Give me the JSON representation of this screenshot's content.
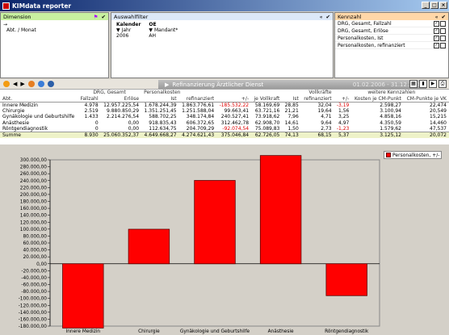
{
  "app": {
    "title": "KIMdata reporter"
  },
  "window_buttons": [
    "_",
    "□",
    "×"
  ],
  "panels": {
    "dimension": {
      "label": "Dimension",
      "item_arrow": "→",
      "item": "Abt. / Monat"
    },
    "filter": {
      "label": "Auswahlfilter",
      "kalender_label": "Kalender",
      "kalender_sub": "Jahr",
      "kalender_val": "2006",
      "oe_label": "OE",
      "oe_sub": "Mandant*",
      "oe_val": "AH"
    },
    "kennzahl": {
      "label": "Kennzahl",
      "items": [
        "DRG, Gesamt, Fallzahl",
        "DRG, Gesamt, Erlöse",
        "Personalkosten, Ist",
        "Personalkosten, refinanziert"
      ]
    }
  },
  "report": {
    "title": "Refinanzierung Ärztlicher Dienst",
    "date_range": "01.02.2006 - 31.12.2006"
  },
  "table": {
    "group_headers": {
      "drg": "DRG, Gesamt",
      "personal": "Personalkosten",
      "vollkraefte": "Vollkräfte",
      "weitere": "weitere Kennzahlen"
    },
    "columns": [
      "Abt.",
      "Fallzahl",
      "Erlöse",
      "Ist",
      "refinanziert",
      "+/-",
      "je Vollkraft",
      "Ist",
      "refinanziert",
      "+/-",
      "Kosten je CM-Punkt",
      "CM-Punkte je VK"
    ],
    "rows": [
      [
        "Innere Medizin",
        "4.978",
        "12.957.225,54",
        "1.678.244,39",
        "1.863.776,61",
        "-185.532,22",
        "58.169,69",
        "28,85",
        "32,04",
        "-3,19",
        "2.598,27",
        "22,474"
      ],
      [
        "Chirurgie",
        "2.519",
        "9.880.850,29",
        "1.351.251,45",
        "1.251.588,04",
        "99.663,41",
        "63.721,16",
        "21,21",
        "19,64",
        "1,56",
        "3.100,94",
        "20,549"
      ],
      [
        "Gynäkologie und Geburtshilfe",
        "1.433",
        "2.214.276,54",
        "588.702,25",
        "348.174,84",
        "240.527,41",
        "73.918,62",
        "7,96",
        "4,71",
        "3,25",
        "4.858,16",
        "15,215"
      ],
      [
        "Anästhesie",
        "0",
        "0,00",
        "918.835,43",
        "606.372,65",
        "312.462,78",
        "62.908,70",
        "14,61",
        "9,64",
        "4,97",
        "4.350,59",
        "14,460"
      ],
      [
        "Röntgendiagnostik",
        "0",
        "0,00",
        "112.634,75",
        "204.709,29",
        "-92.074,54",
        "75.089,83",
        "1,50",
        "2,73",
        "-1,23",
        "1.579,62",
        "47,537"
      ]
    ],
    "sum": [
      "Summe",
      "8.930",
      "25.060.352,37",
      "4.649.668,27",
      "4.274.621,43",
      "375.046,84",
      "62.726,05",
      "74,13",
      "68,15",
      "5,37",
      "3.125,12",
      "20,072"
    ]
  },
  "chart_data": {
    "type": "bar",
    "categories": [
      "Innere Medizin",
      "Chirurgie",
      "Gynäkologie und Geburtshilfe",
      "Anästhesie",
      "Röntgendiagnostik"
    ],
    "series": [
      {
        "name": "Personalkosten, +/-",
        "values": [
          -185532.22,
          99663.41,
          240527.41,
          312462.78,
          -92074.54
        ]
      }
    ],
    "ylim": [
      -180000,
      300000
    ],
    "ytick_step": 20000,
    "grid": false,
    "legend": "top-right",
    "colors": {
      "bar": "#ff0000",
      "bar_edge": "#600000"
    }
  }
}
